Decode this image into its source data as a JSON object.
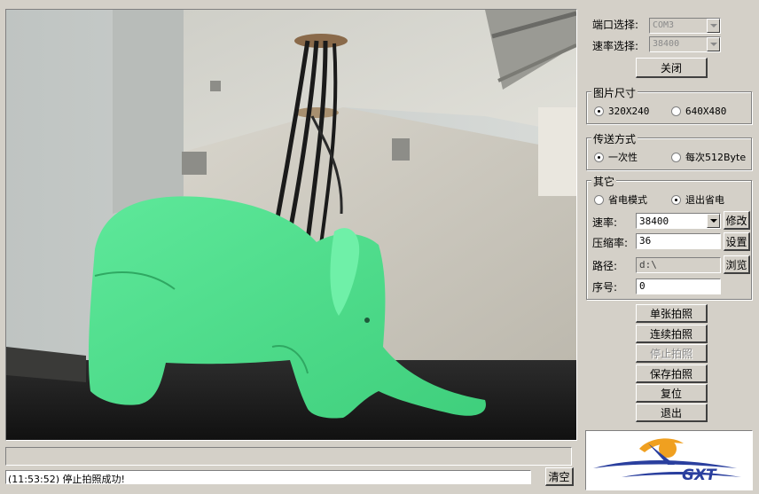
{
  "port": {
    "port_label": "端口选择:",
    "port_value": "COM3",
    "baud_label": "速率选择:",
    "baud_value": "38400",
    "close_button": "关闭"
  },
  "image_size": {
    "title": "图片尺寸",
    "options": [
      "320X240",
      "640X480"
    ],
    "selected": "320X240"
  },
  "transfer": {
    "title": "传送方式",
    "options": [
      "一次性",
      "每次512Byte"
    ],
    "selected": "一次性"
  },
  "other": {
    "title": "其它",
    "power_options": [
      "省电模式",
      "退出省电"
    ],
    "power_selected": "退出省电",
    "rate_label": "速率:",
    "rate_value": "38400",
    "modify_button": "修改",
    "compress_label": "压缩率:",
    "compress_value": "36",
    "set_button": "设置",
    "path_label": "路径:",
    "path_value": "d:\\",
    "browse_button": "浏览",
    "seq_label": "序号:",
    "seq_value": "0"
  },
  "actions": {
    "single": "单张拍照",
    "continuous": "连续拍照",
    "stop": "停止拍照",
    "save": "保存拍照",
    "reset": "复位",
    "exit": "退出"
  },
  "status": {
    "log": "(11:53:52) 停止拍照成功!",
    "clear_button": "清空"
  },
  "logo": {
    "text": "GXT"
  },
  "colors": {
    "face": "#d4d0c8",
    "logo_blue": "#2a3f9e",
    "logo_orange": "#f0a020"
  }
}
